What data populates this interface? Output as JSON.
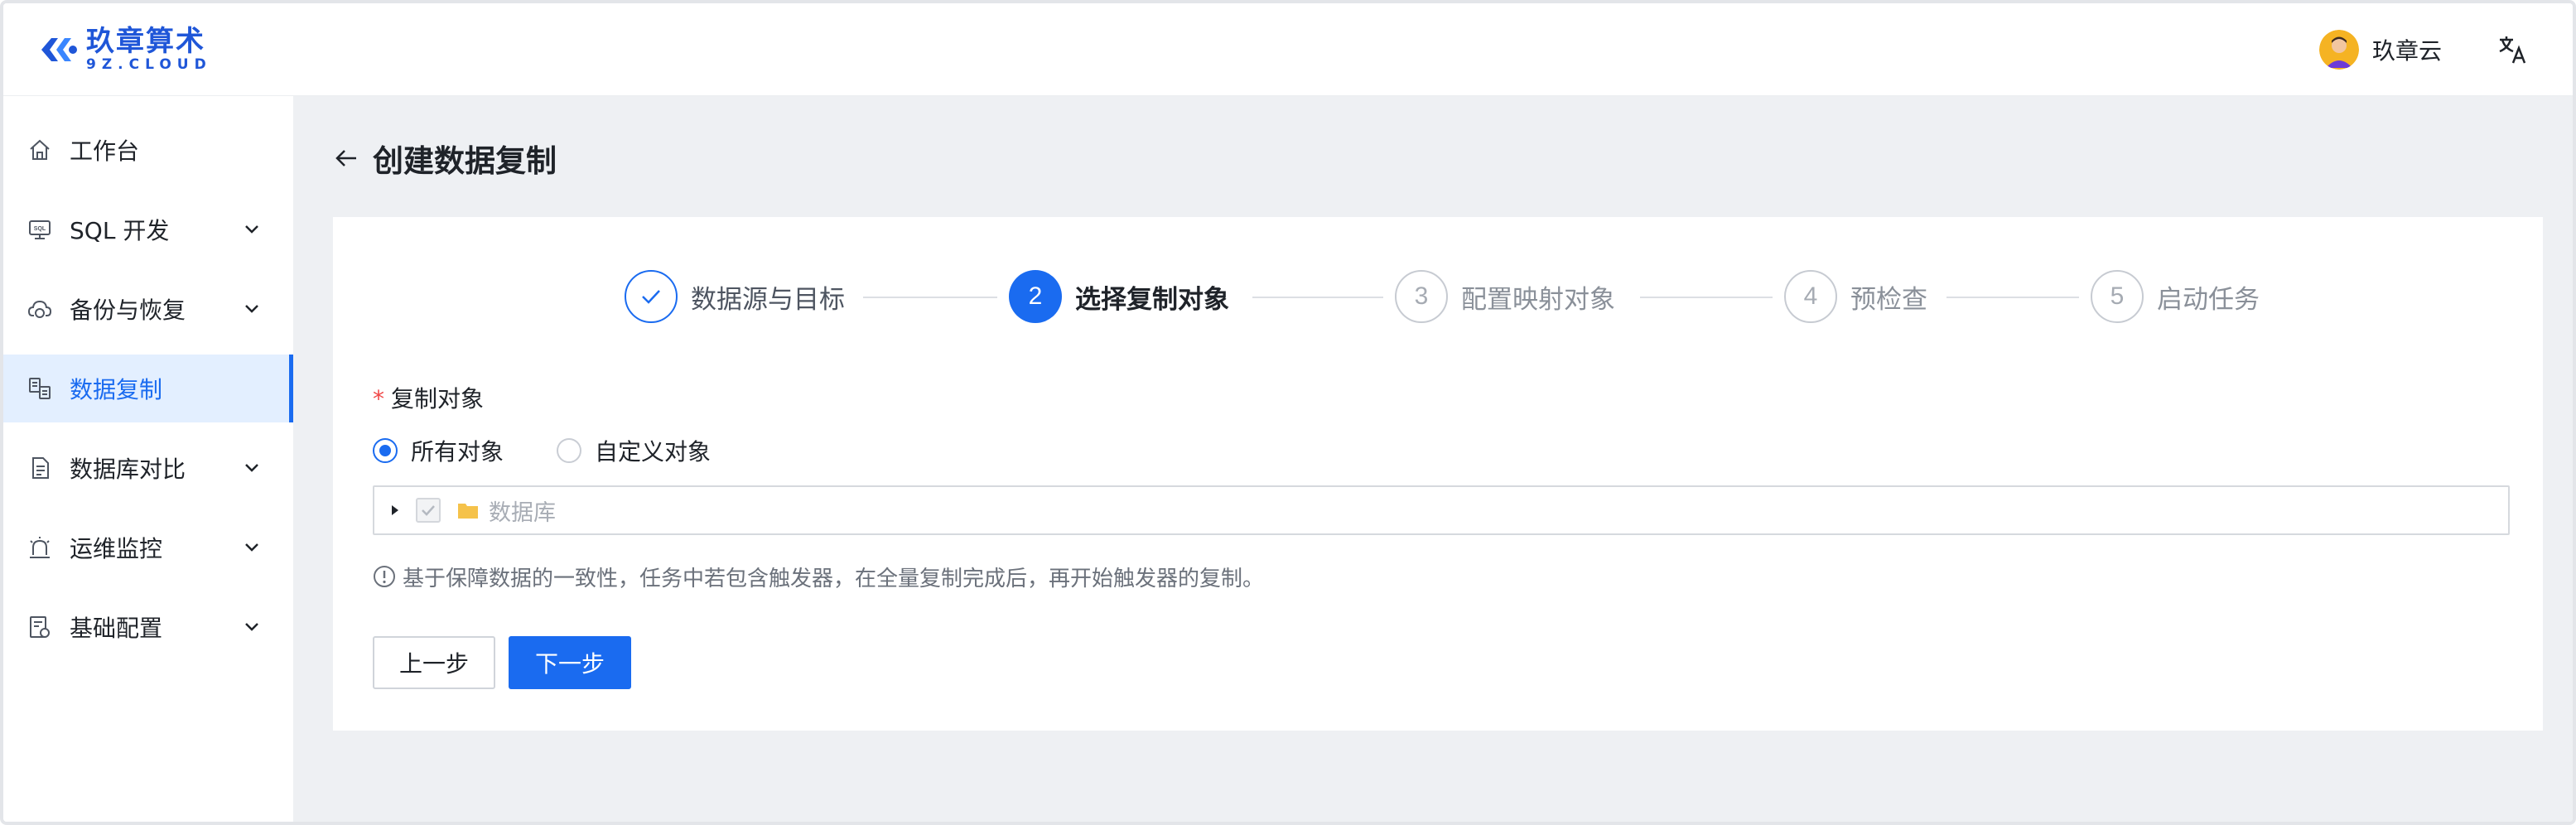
{
  "app": {
    "logo_cn": "玖章算术",
    "logo_en": "9Z.CLOUD",
    "user_name": "玖章云",
    "brand_color": "#1a6bf0"
  },
  "sidebar": {
    "items": [
      {
        "label": "工作台",
        "icon": "home-icon",
        "has_children": false,
        "active": false
      },
      {
        "label": "SQL 开发",
        "icon": "sql-monitor-icon",
        "has_children": true,
        "active": false
      },
      {
        "label": "备份与恢复",
        "icon": "cloud-sync-icon",
        "has_children": true,
        "active": false
      },
      {
        "label": "数据复制",
        "icon": "data-copy-icon",
        "has_children": false,
        "active": true
      },
      {
        "label": "数据库对比",
        "icon": "compare-doc-icon",
        "has_children": true,
        "active": false
      },
      {
        "label": "运维监控",
        "icon": "alarm-icon",
        "has_children": true,
        "active": false
      },
      {
        "label": "基础配置",
        "icon": "config-icon",
        "has_children": true,
        "active": false
      }
    ]
  },
  "page": {
    "title": "创建数据复制"
  },
  "steps": [
    {
      "number": "1",
      "label": "数据源与目标",
      "status": "done"
    },
    {
      "number": "2",
      "label": "选择复制对象",
      "status": "current"
    },
    {
      "number": "3",
      "label": "配置映射对象",
      "status": "todo"
    },
    {
      "number": "4",
      "label": "预检查",
      "status": "todo"
    },
    {
      "number": "5",
      "label": "启动任务",
      "status": "todo"
    }
  ],
  "form": {
    "required_mark": "*",
    "field_label": "复制对象",
    "radio_options": [
      {
        "label": "所有对象",
        "checked": true
      },
      {
        "label": "自定义对象",
        "checked": false
      }
    ],
    "tree": {
      "node_label": "数据库",
      "checked": true,
      "disabled": true
    },
    "hint": "基于保障数据的一致性，任务中若包含触发器，在全量复制完成后，再开始触发器的复制。"
  },
  "buttons": {
    "prev_label": "上一步",
    "next_label": "下一步"
  }
}
